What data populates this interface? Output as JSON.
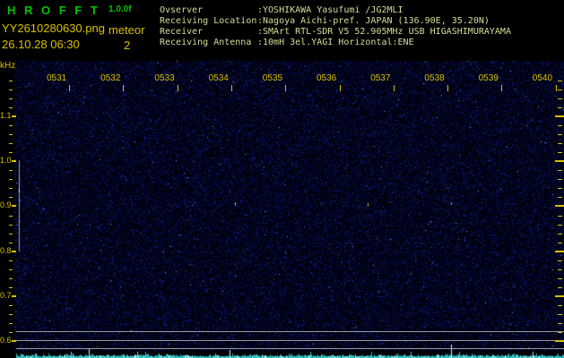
{
  "app": {
    "title": "H R O F F T",
    "version": "1.0.0f",
    "filename": "YY2610280630.png",
    "mode": "meteor",
    "datetime": "26.10.28 06:30",
    "count": "2"
  },
  "station": {
    "rows": [
      {
        "label": "Ovserver",
        "value": ":YOSHIKAWA Yasufumi /JG2MLI"
      },
      {
        "label": "Receiving Location",
        "value": ":Nagoya Aichi-pref. JAPAN (136.90E, 35.20N)"
      },
      {
        "label": "Receiver",
        "value": ":SMArt RTL-SDR V5 52.905MHz USB HIGASHIMURAYAMA"
      },
      {
        "label": "Receiving Antenna",
        "value": ":10mH 3el.YAGI Horizontal:ENE"
      }
    ]
  },
  "spectrogram": {
    "freq_axis_unit": "kHz",
    "freq_labels": [
      "1.1",
      "1.0",
      "0.9",
      "0.8",
      "0.7",
      "0.6"
    ],
    "time_labels": [
      "0531",
      "0532",
      "0533",
      "0534",
      "0535",
      "0536",
      "0537",
      "0538",
      "0539",
      "0540"
    ],
    "events": [
      {
        "type": "carrier-trace",
        "time": "0530",
        "freq_khz_from": 1.0,
        "freq_khz_to": 0.8
      },
      {
        "type": "echo",
        "time": "0533.97",
        "freq_khz": 0.905
      },
      {
        "type": "echo",
        "time": "0536.40",
        "freq_khz": 0.902
      },
      {
        "type": "echo",
        "time": "0537.93",
        "freq_khz": 0.904
      }
    ]
  },
  "colors": {
    "title_green": "#00c400",
    "label_yellow": "#d8c000",
    "station_text": "#d6dc9a",
    "band_line_gray": "#9a9a9a",
    "level_cyan": "#40d8d8",
    "noise_blue": "#1024a0",
    "background": "#000000"
  }
}
